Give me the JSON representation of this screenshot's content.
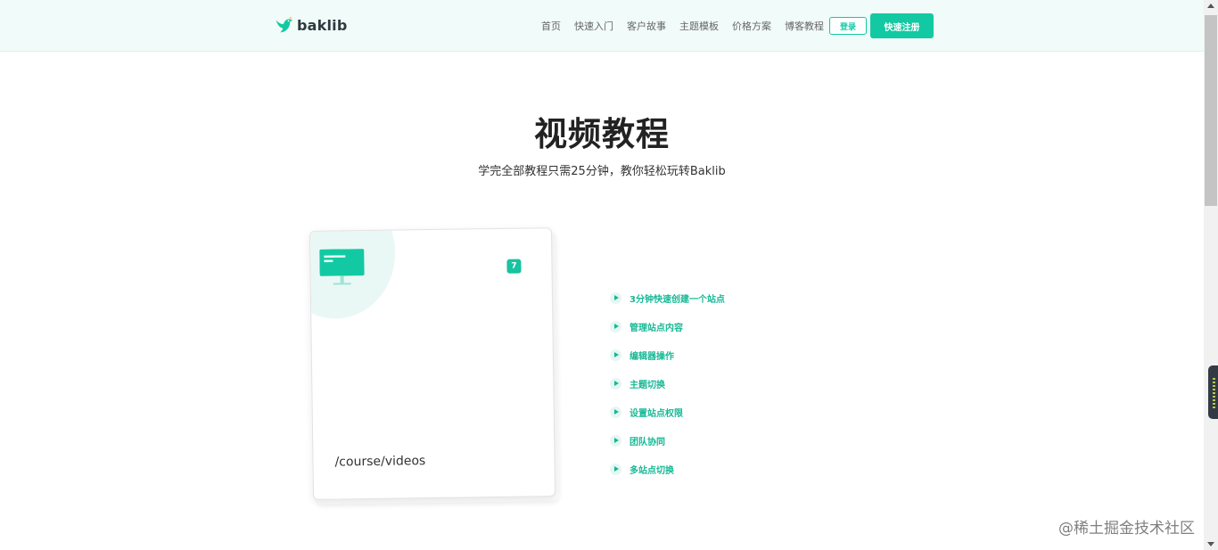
{
  "header": {
    "logo_text": "baklib",
    "nav": [
      "首页",
      "快速入门",
      "客户故事",
      "主题模板",
      "价格方案",
      "博客教程"
    ],
    "login_label": "登录",
    "signup_label": "快速注册",
    "accent": "#13c9a3"
  },
  "hero": {
    "title": "视频教程",
    "subtitle": "学完全部教程只需25分钟，教你轻松玩转Baklib"
  },
  "card": {
    "badge": "7",
    "path": "/course/videos",
    "icon": "monitor-icon"
  },
  "videos": [
    "3分钟快速创建一个站点",
    "管理站点内容",
    "编辑器操作",
    "主题切换",
    "设置站点权限",
    "团队协同",
    "多站点切换"
  ],
  "watermark": "@稀土掘金技术社区"
}
